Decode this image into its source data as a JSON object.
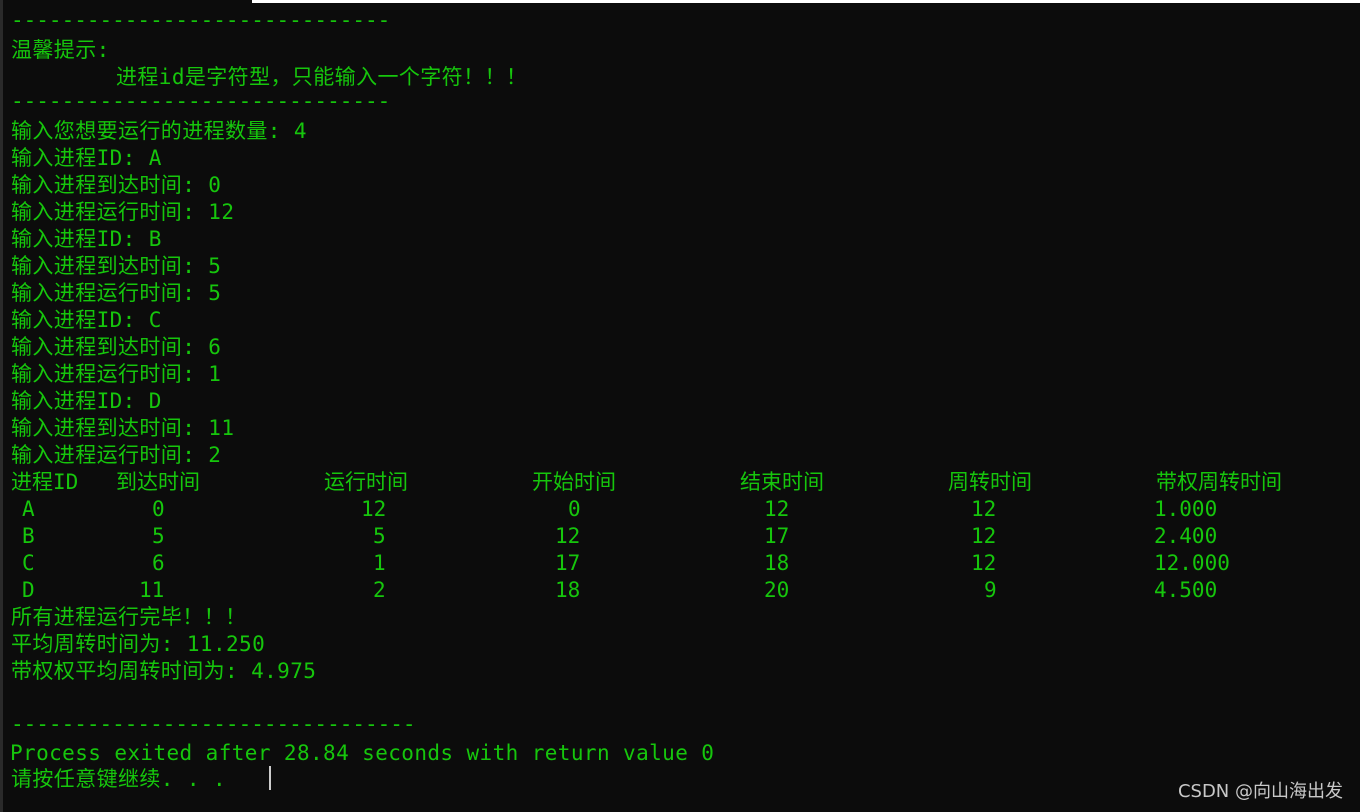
{
  "console": {
    "separator_top": "------------------------------",
    "tip_title": "温馨提示:",
    "tip_body": "进程id是字符型，只能输入一个字符！！！",
    "separator_mid": "------------------------------",
    "prompt_count": "输入您想要运行的进程数量: 4",
    "inputs": [
      "输入进程ID: A",
      "输入进程到达时间: 0",
      "输入进程运行时间: 12",
      "输入进程ID: B",
      "输入进程到达时间: 5",
      "输入进程运行时间: 5",
      "输入进程ID: C",
      "输入进程到达时间: 6",
      "输入进程运行时间: 1",
      "输入进程ID: D",
      "输入进程到达时间: 11",
      "输入进程运行时间: 2"
    ],
    "table": {
      "headers": [
        "进程ID",
        "到达时间",
        "运行时间",
        "开始时间",
        "结束时间",
        "周转时间",
        "带权周转时间"
      ],
      "rows": [
        [
          "A",
          "0",
          "12",
          "0",
          "12",
          "12",
          "1.000"
        ],
        [
          "B",
          "5",
          "5",
          "12",
          "17",
          "12",
          "2.400"
        ],
        [
          "C",
          "6",
          "1",
          "17",
          "18",
          "12",
          "12.000"
        ],
        [
          "D",
          "11",
          "2",
          "18",
          "20",
          "9",
          "4.500"
        ]
      ]
    },
    "done_message": "所有进程运行完毕！！！",
    "avg_turnaround": "平均周转时间为: 11.250",
    "avg_weighted_turnaround": "带权权平均周转时间为: 4.975",
    "separator_bottom": "--------------------------------",
    "process_exit": "Process exited after 28.84 seconds with return value 0",
    "press_any_key": "请按任意键继续. . ."
  },
  "watermark": "CSDN @向山海出发",
  "colors": {
    "background": "#0c0c0c",
    "text": "#16c60c",
    "watermark": "#c8c8c8"
  }
}
